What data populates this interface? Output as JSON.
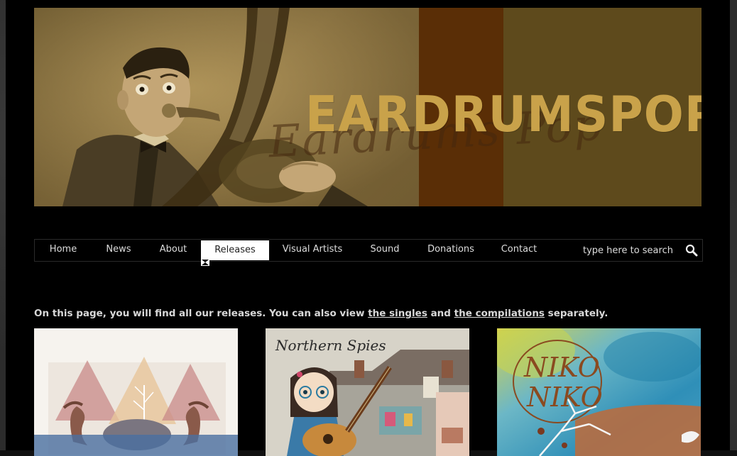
{
  "banner": {
    "logo_text": "EARDRUMSPOP",
    "logo_script": "Eardrums Pop"
  },
  "nav": {
    "items": [
      {
        "label": "Home",
        "active": false
      },
      {
        "label": "News",
        "active": false
      },
      {
        "label": "About",
        "active": false
      },
      {
        "label": "Releases",
        "active": true
      },
      {
        "label": "Visual Artists",
        "active": false
      },
      {
        "label": "Sound",
        "active": false
      },
      {
        "label": "Donations",
        "active": false
      },
      {
        "label": "Contact",
        "active": false
      }
    ],
    "search_placeholder": "type here to search",
    "search_icon": "magnifier-icon"
  },
  "intro": {
    "text_before": "On this page, you will find all our releases. You can also view ",
    "link_singles": "the singles",
    "text_middle": " and ",
    "link_compilations": "the compilations",
    "text_after": " separately."
  },
  "releases": [
    {
      "art": "whale-tails-triangles"
    },
    {
      "title": "Northern Spies",
      "art": "girl-with-guitar-house"
    },
    {
      "title": "NIKO NIKO",
      "art": "watercolor-niko-niko"
    }
  ],
  "colors": {
    "background": "#000000",
    "banner_gold": "#a88d52",
    "banner_stripe": "#5a2e06",
    "logo": "#c9a24a",
    "text": "#d8d8d8"
  }
}
